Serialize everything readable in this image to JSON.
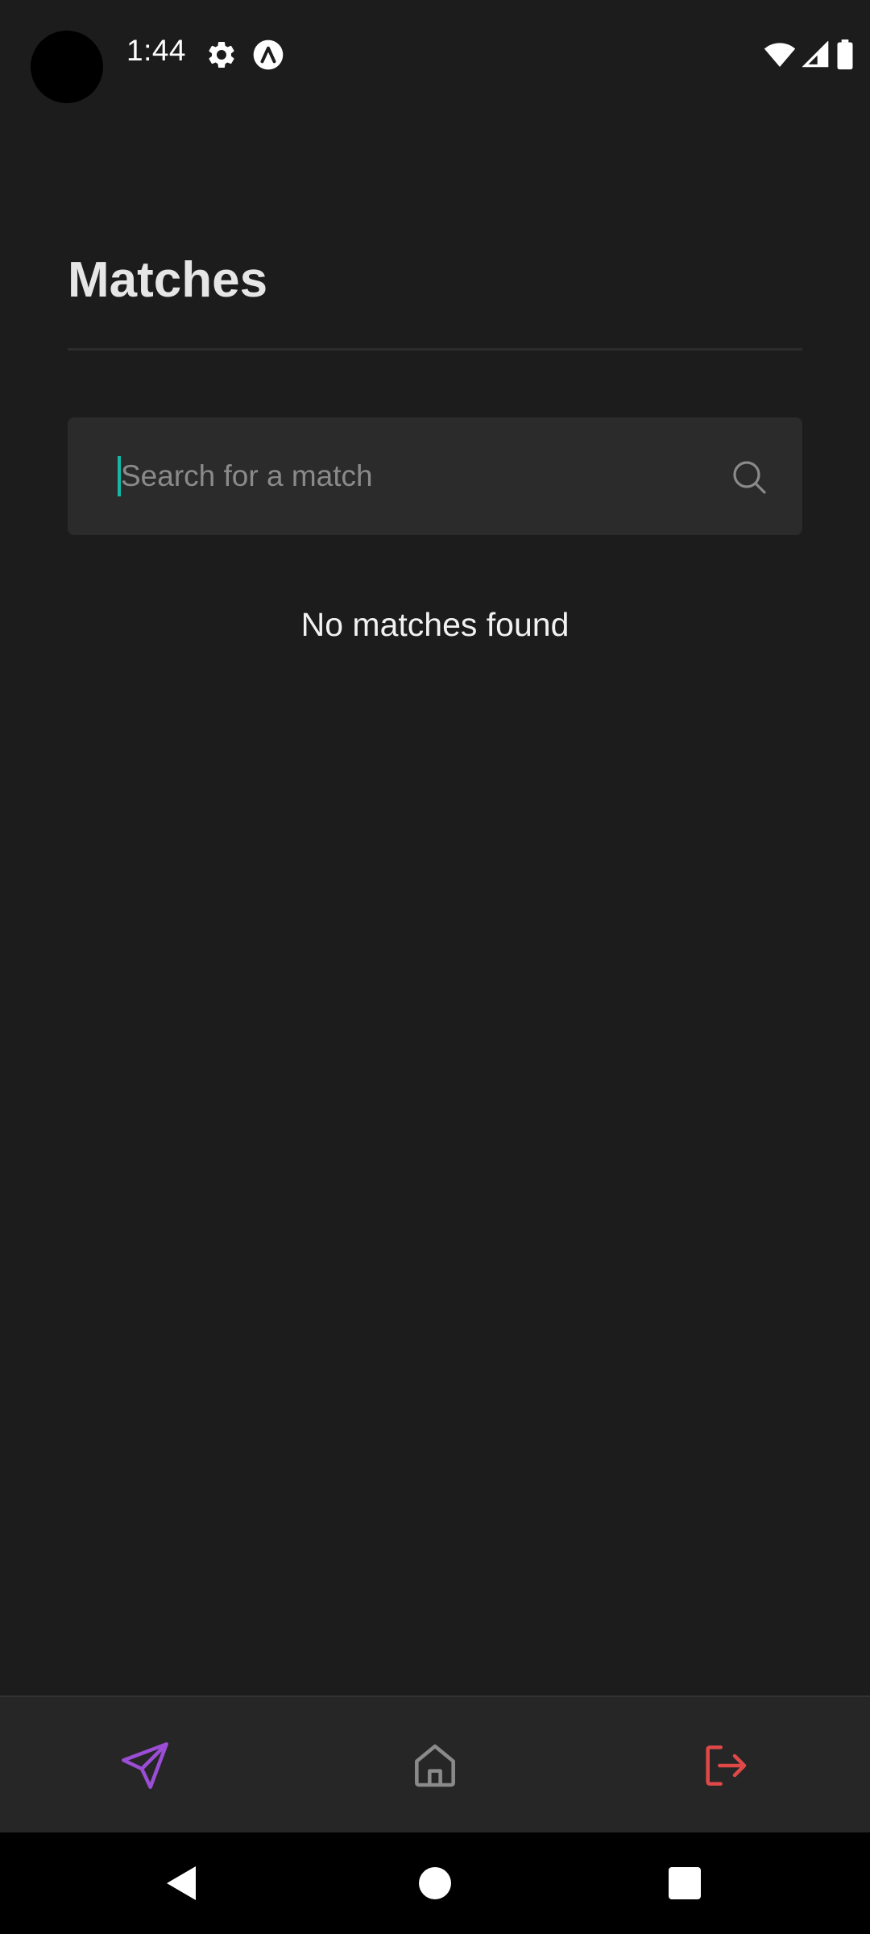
{
  "status_bar": {
    "time": "1:44",
    "icons": [
      "gear-icon",
      "app-notification-icon",
      "wifi-icon",
      "signal-icon",
      "battery-icon"
    ]
  },
  "page": {
    "title": "Matches"
  },
  "search": {
    "placeholder": "Search for a match",
    "value": ""
  },
  "empty_state": {
    "text": "No matches found"
  },
  "tab_bar": {
    "tabs": [
      {
        "icon": "send-icon",
        "color": "#9b4dd6"
      },
      {
        "icon": "home-icon",
        "color": "#8a8a8a"
      },
      {
        "icon": "logout-icon",
        "color": "#e04848"
      }
    ]
  },
  "nav_bar": {
    "buttons": [
      "back-icon",
      "home-circle-icon",
      "recents-icon"
    ]
  },
  "colors": {
    "background": "#1c1c1c",
    "search_background": "#2b2b2b",
    "caret": "#14b8a6",
    "tab_bar_background": "#262626"
  }
}
